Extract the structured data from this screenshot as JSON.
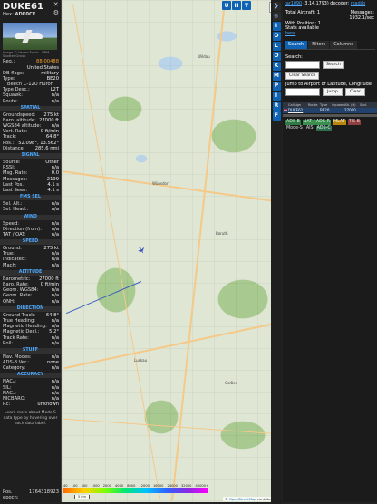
{
  "info": {
    "callsign": "DUKE61",
    "hex_label": "Hex:",
    "hex": "ADF0CE",
    "photo_credit": "Image © Varani Ennio - VRM Spotter Group",
    "reg_label": "Reg.:",
    "reg": "88-00488",
    "country": "United States",
    "db_flags_label": "DB flags:",
    "db_flags": "military",
    "type_label": "Type:",
    "type": "BE20",
    "type_name": "Beech C-12U Huron",
    "type_desc_label": "Type Desc.:",
    "type_desc": "L2T",
    "squawk_label": "Squawk:",
    "squawk": "n/a",
    "route_label": "Route:",
    "route": "n/a",
    "spatial_title": "SPATIAL",
    "spatial": [
      {
        "k": "Groundspeed:",
        "v": "275 kt"
      },
      {
        "k": "Baro. altitude:",
        "v": "27000 ft"
      },
      {
        "k": "WGS84 altitude:",
        "v": "n/a"
      },
      {
        "k": "Vert. Rate:",
        "v": "0 ft/min"
      },
      {
        "k": "Track:",
        "v": "64.8°"
      },
      {
        "k": "Pos.:",
        "v": "52.098°, 13.562°"
      },
      {
        "k": "Distance:",
        "v": "285.6 nmi"
      }
    ],
    "signal_title": "SIGNAL",
    "signal": [
      {
        "k": "Source:",
        "v": "Other"
      },
      {
        "k": "RSSI:",
        "v": "n/a"
      },
      {
        "k": "Msg. Rate:",
        "v": "0.0"
      },
      {
        "k": "Messages:",
        "v": "2199"
      },
      {
        "k": "Last Pos.:",
        "v": "4.1 s"
      },
      {
        "k": "Last Seen:",
        "v": "4.1 s"
      }
    ],
    "fms_title": "FMS SEL",
    "fms": [
      {
        "k": "Sel. Alt.:",
        "v": "n/a"
      },
      {
        "k": "Sel. Head.:",
        "v": "n/a"
      }
    ],
    "wind_title": "WIND",
    "wind": [
      {
        "k": "Speed:",
        "v": "n/a"
      },
      {
        "k": "Direction (from):",
        "v": "n/a"
      },
      {
        "k": "TAT / OAT:",
        "v": "n/a"
      }
    ],
    "speed_title": "SPEED",
    "speed": [
      {
        "k": "Ground:",
        "v": "275 kt"
      },
      {
        "k": "True:",
        "v": "n/a"
      },
      {
        "k": "Indicated:",
        "v": "n/a"
      },
      {
        "k": "Mach:",
        "v": "n/a"
      }
    ],
    "altitude_title": "ALTITUDE",
    "altitude": [
      {
        "k": "Barometric:",
        "v": "27000 ft"
      },
      {
        "k": "Baro. Rate:",
        "v": "0 ft/min"
      },
      {
        "k": "Geom. WGS84:",
        "v": "n/a"
      },
      {
        "k": "Geom. Rate:",
        "v": "n/a"
      },
      {
        "k": "QNH:",
        "v": "n/a"
      }
    ],
    "direction_title": "DIRECTION",
    "direction": [
      {
        "k": "Ground Track:",
        "v": "64.8°"
      },
      {
        "k": "True Heading:",
        "v": "n/a"
      },
      {
        "k": "Magnetic Heading:",
        "v": "n/a"
      },
      {
        "k": "Magnetic Decl.:",
        "v": "5.2°"
      },
      {
        "k": "Track Rate:",
        "v": "n/a"
      },
      {
        "k": "Roll:",
        "v": "n/a"
      }
    ],
    "stuff_title": "STUFF",
    "stuff": [
      {
        "k": "Nav. Modes:",
        "v": "n/a"
      },
      {
        "k": "ADS-B Ver.:",
        "v": "none"
      },
      {
        "k": "Category:",
        "v": "n/a"
      }
    ],
    "accuracy_title": "ACCURACY",
    "accuracy": [
      {
        "k": "NACₚ:",
        "v": "n/a"
      },
      {
        "k": "SIL:",
        "v": "n/a"
      },
      {
        "k": "NACᵥ:",
        "v": "n/a"
      },
      {
        "k": "NICBARO:",
        "v": "n/a"
      },
      {
        "k": "Rc:",
        "v": "unknown"
      }
    ],
    "learn_more": "Learn more about Mode S data type by hovering over each data label.",
    "pos_epoch_label": "Pos. epoch:",
    "pos_epoch": "1764318923"
  },
  "map": {
    "buttons": [
      "U",
      "H",
      "T"
    ],
    "labels": [
      "Wildau",
      "Wünsdorf",
      "Baruth",
      "Luckau",
      "Golßen"
    ],
    "alt_ticks": [
      "40",
      "100",
      "500",
      "1000",
      "2000",
      "4000",
      "8000",
      "12000",
      "16000",
      "24000",
      "32000",
      "40000+"
    ],
    "scale": "5 km",
    "attribution_prefix": "© ",
    "attribution_link": "OpenStreetMap",
    "attribution_suffix": " contributors"
  },
  "strip": {
    "buttons": [
      "I",
      "O",
      "L",
      "O",
      "K",
      "M",
      "P",
      "I",
      "R",
      "F"
    ]
  },
  "side": {
    "title_link": "tar1090",
    "title_rest": " (3.14.1793) decoder: ",
    "title_link2": "readsb",
    "total_aircraft_label": "Total Aircraft:",
    "total_aircraft": "1",
    "messages_label": "Messages:",
    "messages_rate": "1932.1/sec",
    "with_position_label": "With Position:",
    "with_position": "1",
    "stats_available": "Stats available",
    "stats_link": "here",
    "tabs": [
      "Search",
      "Filters",
      "Columns"
    ],
    "search_label": "Search:",
    "search_button": "Search",
    "clear_search": "Clear Search",
    "jump_label": "Jump to Airport or Latitude, Longitude:",
    "jump_button": "Jump",
    "clear_button": "Clear",
    "columns": [
      "",
      "Callsign",
      "Route",
      "Type",
      "Squawk",
      "Alt. (ft)",
      "Spd."
    ],
    "row": {
      "callsign": "DUKE61",
      "type": "BE20",
      "alt": "27000"
    },
    "badges": [
      "ADS-B",
      "UAT / ADS-R",
      "MLAT",
      "TIS-B",
      "Mode-S",
      "AIS",
      "ADS-C"
    ]
  }
}
